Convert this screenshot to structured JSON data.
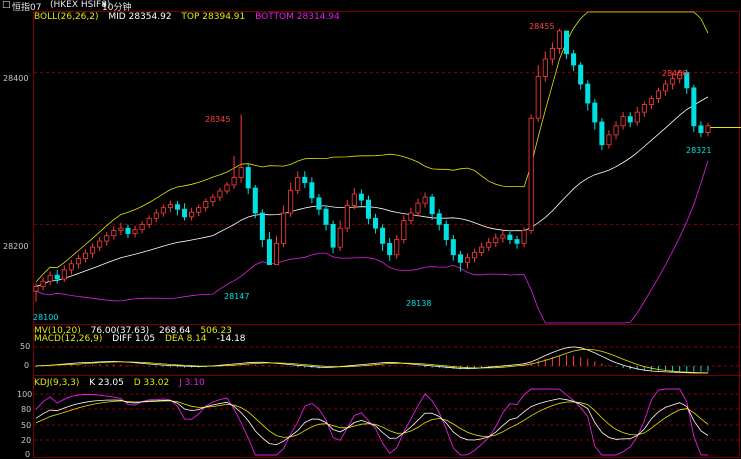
{
  "titlebar": {
    "menu_icon": "□",
    "instrument": "恒指07",
    "code": "(HKEX HSIF8)",
    "period": "10分钟",
    "period_caret": "▾"
  },
  "boll": {
    "label": "BOLL(26,26,2)",
    "mid_label": "MID 28354.92",
    "top_label": "TOP 28394.91",
    "bottom_label": "BOTTOM 28314.94",
    "colors": {
      "mid": "#ffffff",
      "top": "#e6e600",
      "bottom": "#e020e0"
    }
  },
  "price_axis": {
    "ylim": [
      28070,
      28480
    ],
    "ticks": [
      "28400",
      "28200"
    ]
  },
  "annotations": {
    "high": "28455",
    "high2": "28400",
    "low1": "28147",
    "low2": "28138",
    "last": "28321",
    "left_low": "28100"
  },
  "mv": {
    "label": "MV(10,20)",
    "v1": "76.00(37.63)",
    "v2": "268.64",
    "v3": "506.23"
  },
  "macd": {
    "label": "MACD(12,26,9)",
    "diff": "DIFF 1.05",
    "dea": "DEA 8.14",
    "hist": "-14.18",
    "axis_ticks": [
      "50",
      "0",
      "-50"
    ]
  },
  "kdj": {
    "label": "KDJ(9,3,3)",
    "k": "K 23.05",
    "d": "D 33.02",
    "j": "J 3.10",
    "axis_ticks": [
      "100",
      "80",
      "50",
      "20",
      "0"
    ]
  },
  "chart_data": [
    {
      "type": "candlestick",
      "title": "",
      "ylim": [
        28070,
        28480
      ],
      "colors": {
        "up": "#ff3b3b",
        "down": "#00e0e0",
        "mid": "#ffffff",
        "top": "#e6e600",
        "bottom": "#e020e0"
      },
      "candles": [
        [
          28112,
          28118,
          28098,
          28122
        ],
        [
          28118,
          28125,
          28113,
          28130
        ],
        [
          28125,
          28133,
          28120,
          28138
        ],
        [
          28133,
          28128,
          28122,
          28140
        ],
        [
          28128,
          28140,
          28124,
          28146
        ],
        [
          28140,
          28148,
          28134,
          28153
        ],
        [
          28148,
          28155,
          28142,
          28160
        ],
        [
          28155,
          28162,
          28150,
          28167
        ],
        [
          28162,
          28170,
          28156,
          28175
        ],
        [
          28170,
          28178,
          28165,
          28183
        ],
        [
          28178,
          28185,
          28172,
          28190
        ],
        [
          28185,
          28192,
          28180,
          28198
        ],
        [
          28192,
          28195,
          28186,
          28202
        ],
        [
          28195,
          28188,
          28182,
          28200
        ],
        [
          28188,
          28193,
          28183,
          28198
        ],
        [
          28193,
          28200,
          28188,
          28204
        ],
        [
          28200,
          28208,
          28195,
          28212
        ],
        [
          28208,
          28215,
          28203,
          28220
        ],
        [
          28215,
          28222,
          28210,
          28226
        ],
        [
          28222,
          28226,
          28216,
          28231
        ],
        [
          28226,
          28220,
          28212,
          28231
        ],
        [
          28220,
          28210,
          28205,
          28228
        ],
        [
          28210,
          28216,
          28205,
          28222
        ],
        [
          28216,
          28222,
          28211,
          28226
        ],
        [
          28222,
          28230,
          28217,
          28234
        ],
        [
          28230,
          28236,
          28224,
          28240
        ],
        [
          28236,
          28244,
          28231,
          28248
        ],
        [
          28244,
          28252,
          28240,
          28256
        ],
        [
          28252,
          28262,
          28247,
          28290
        ],
        [
          28262,
          28275,
          28255,
          28345
        ],
        [
          28275,
          28248,
          28240,
          28280
        ],
        [
          28248,
          28215,
          28208,
          28252
        ],
        [
          28215,
          28180,
          28170,
          28220
        ],
        [
          28180,
          28147,
          28147,
          28190
        ],
        [
          28147,
          28175,
          28147,
          28185
        ],
        [
          28175,
          28215,
          28170,
          28225
        ],
        [
          28215,
          28245,
          28210,
          28255
        ],
        [
          28245,
          28262,
          28240,
          28270
        ],
        [
          28262,
          28255,
          28248,
          28270
        ],
        [
          28255,
          28235,
          28228,
          28262
        ],
        [
          28235,
          28220,
          28212,
          28240
        ],
        [
          28220,
          28200,
          28192,
          28225
        ],
        [
          28200,
          28170,
          28162,
          28205
        ],
        [
          28170,
          28195,
          28165,
          28205
        ],
        [
          28195,
          28225,
          28190,
          28232
        ],
        [
          28225,
          28240,
          28220,
          28248
        ],
        [
          28240,
          28232,
          28225,
          28246
        ],
        [
          28232,
          28208,
          28200,
          28238
        ],
        [
          28208,
          28195,
          28188,
          28214
        ],
        [
          28195,
          28175,
          28165,
          28200
        ],
        [
          28175,
          28160,
          28152,
          28182
        ],
        [
          28160,
          28180,
          28155,
          28186
        ],
        [
          28180,
          28205,
          28175,
          28212
        ],
        [
          28205,
          28215,
          28200,
          28222
        ],
        [
          28215,
          28228,
          28210,
          28234
        ],
        [
          28228,
          28236,
          28222,
          28242
        ],
        [
          28236,
          28214,
          28206,
          28240
        ],
        [
          28214,
          28200,
          28192,
          28220
        ],
        [
          28200,
          28180,
          28172,
          28205
        ],
        [
          28180,
          28160,
          28152,
          28186
        ],
        [
          28160,
          28150,
          28138,
          28165
        ],
        [
          28150,
          28156,
          28142,
          28162
        ],
        [
          28156,
          28163,
          28150,
          28168
        ],
        [
          28163,
          28170,
          28158,
          28176
        ],
        [
          28170,
          28176,
          28165,
          28182
        ],
        [
          28176,
          28182,
          28170,
          28188
        ],
        [
          28182,
          28186,
          28176,
          28192
        ],
        [
          28186,
          28180,
          28174,
          28190
        ],
        [
          28180,
          28175,
          28168,
          28185
        ],
        [
          28175,
          28192,
          28170,
          28196
        ],
        [
          28192,
          28340,
          28188,
          28345
        ],
        [
          28340,
          28395,
          28335,
          28410
        ],
        [
          28395,
          28418,
          28388,
          28428
        ],
        [
          28418,
          28432,
          28410,
          28440
        ],
        [
          28432,
          28455,
          28425,
          28458
        ],
        [
          28455,
          28425,
          28418,
          28455
        ],
        [
          28425,
          28410,
          28402,
          28430
        ],
        [
          28410,
          28385,
          28378,
          28414
        ],
        [
          28385,
          28360,
          28350,
          28390
        ],
        [
          28360,
          28335,
          28325,
          28365
        ],
        [
          28335,
          28305,
          28298,
          28340
        ],
        [
          28305,
          28318,
          28300,
          28324
        ],
        [
          28318,
          28330,
          28312,
          28336
        ],
        [
          28330,
          28342,
          28325,
          28348
        ],
        [
          28342,
          28335,
          28328,
          28348
        ],
        [
          28335,
          28348,
          28330,
          28355
        ],
        [
          28348,
          28358,
          28342,
          28362
        ],
        [
          28358,
          28366,
          28352,
          28370
        ],
        [
          28366,
          28376,
          28360,
          28380
        ],
        [
          28376,
          28385,
          28370,
          28390
        ],
        [
          28385,
          28392,
          28378,
          28400
        ],
        [
          28392,
          28400,
          28386,
          28404
        ],
        [
          28400,
          28380,
          28372,
          28404
        ],
        [
          28380,
          28330,
          28322,
          28384
        ],
        [
          28330,
          28321,
          28315,
          28336
        ],
        [
          28321,
          28330,
          28316,
          28334
        ]
      ]
    },
    {
      "type": "bar",
      "title": "",
      "series": [
        {
          "name": "DIFF",
          "color": "#ffffff"
        },
        {
          "name": "DEA",
          "color": "#e6e600"
        }
      ],
      "ylim": [
        -50,
        50
      ],
      "values": [
        -3,
        -2,
        -1,
        0,
        1,
        2,
        2,
        3,
        3,
        4,
        4,
        4,
        3,
        2,
        1,
        0,
        -1,
        -2,
        -2,
        -3,
        -3,
        -4,
        -4,
        -4,
        -3,
        -2,
        -1,
        0,
        1,
        2,
        3,
        3,
        2,
        1,
        0,
        -1,
        -2,
        -3,
        -4,
        -5,
        -6,
        -5,
        -4,
        -3,
        -2,
        -1,
        0,
        1,
        2,
        3,
        2,
        1,
        0,
        -1,
        -2,
        -3,
        -4,
        -5,
        -6,
        -7,
        -8,
        -7,
        -6,
        -5,
        -4,
        -3,
        -2,
        -1,
        0,
        2,
        8,
        14,
        18,
        22,
        26,
        28,
        26,
        22,
        18,
        12,
        6,
        2,
        -2,
        -5,
        -8,
        -10,
        -11,
        -12,
        -12,
        -13,
        -13,
        -14,
        -14,
        -14,
        -14,
        -14
      ]
    },
    {
      "type": "line",
      "title": "",
      "series": [
        {
          "name": "K",
          "color": "#ffffff"
        },
        {
          "name": "D",
          "color": "#e6e600"
        },
        {
          "name": "J",
          "color": "#e020e0"
        }
      ],
      "ylim": [
        0,
        110
      ]
    }
  ]
}
